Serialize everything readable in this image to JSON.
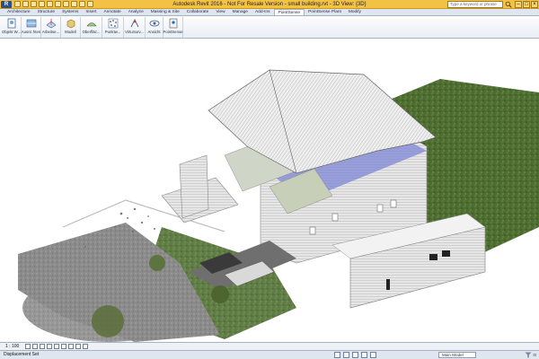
{
  "window": {
    "title": "Autodesk Revit 2016 - Not For Resale Version -  small building.rvt - 3D View: {3D}",
    "search_placeholder": "Type a keyword or phrase",
    "app_button": "R"
  },
  "tabs": [
    {
      "label": "Architecture"
    },
    {
      "label": "Structure"
    },
    {
      "label": "Systems"
    },
    {
      "label": "Insert"
    },
    {
      "label": "Annotate"
    },
    {
      "label": "Analyze"
    },
    {
      "label": "Massing & Site"
    },
    {
      "label": "Collaborate"
    },
    {
      "label": "View"
    },
    {
      "label": "Manage"
    },
    {
      "label": "Add-Ins"
    },
    {
      "label": "PointSense"
    },
    {
      "label": "PointSense Plant"
    },
    {
      "label": "Modify"
    }
  ],
  "active_tab": "PointSense",
  "ribbon": {
    "tools": [
      {
        "label": "Objekt W..."
      },
      {
        "label": "Ausric hten"
      },
      {
        "label": "Arbeitse..."
      },
      {
        "label": "Modell"
      },
      {
        "label": "Oberfläc..."
      },
      {
        "label": "Punktw..."
      },
      {
        "label": "VirtuSurv..."
      },
      {
        "label": "Ansicht"
      },
      {
        "label": "PointSense"
      }
    ]
  },
  "view_control": {
    "scale": "1 : 100"
  },
  "statusbar": {
    "message": "Displacement Set",
    "workset": "Main Model",
    "filter_count": ":0"
  },
  "colors": {
    "title_bar": "#f3c244",
    "ribbon_bg": "#e9eef5",
    "grass": "#4a6b2e",
    "asphalt": "#8c8c8c",
    "roof": "#e8e8e8"
  }
}
